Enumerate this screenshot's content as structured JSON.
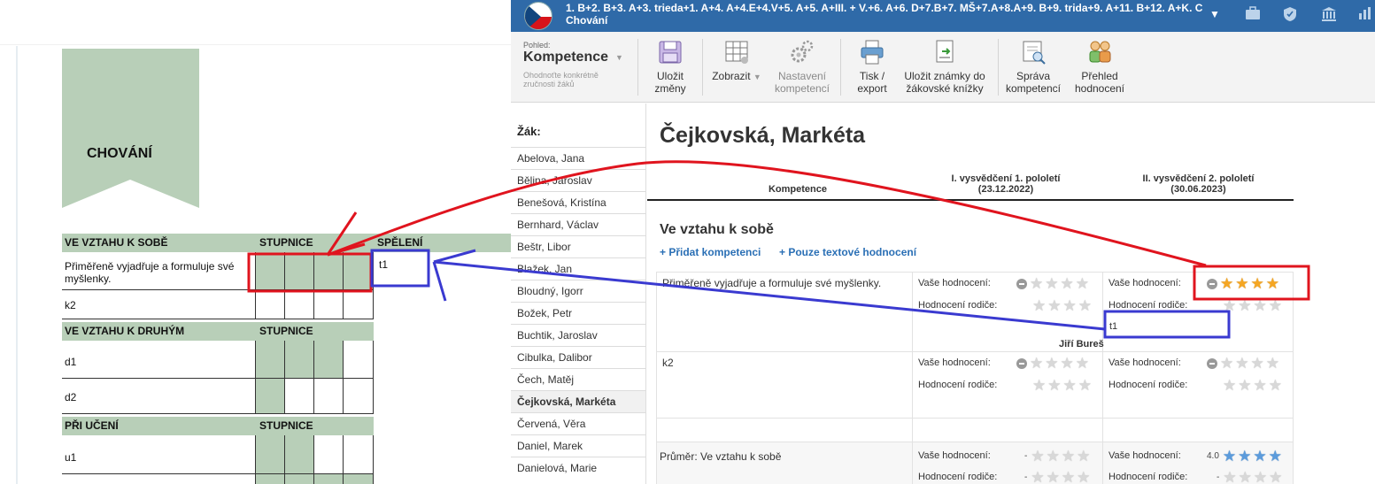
{
  "document": {
    "ribbon_title": "CHOVÁNÍ",
    "sections": [
      {
        "title": "VE VZTAHU K SOBĚ",
        "scale_header": "STUPNICE",
        "extra_header": "SPĚLENÍ",
        "rows": [
          {
            "label": "Přiměřeně vyjadřuje a formuluje své myšlenky.",
            "note": "t1"
          },
          {
            "label": "k2"
          }
        ]
      },
      {
        "title": "VE VZTAHU K DRUHÝM",
        "scale_header": "STUPNICE",
        "rows": [
          {
            "label": "d1"
          },
          {
            "label": "d2"
          }
        ]
      },
      {
        "title": "PŘI UČENÍ",
        "scale_header": "STUPNICE",
        "rows": [
          {
            "label": "u1"
          }
        ]
      }
    ],
    "colors": {
      "accent_green": "#b8cfb8"
    }
  },
  "app": {
    "topbar": {
      "classes_line": "1. B+2. B+3. A+3. trieda+1. A+4. A+4.E+4.V+5. A+5. A+III. + V.+6. A+6. D+7.B+7. MŠ+7.A+8.A+9. B+9. trida+9. A+11. B+12. A+K. C",
      "subtitle": "Chování",
      "icons": [
        "briefcase-icon",
        "shield-icon",
        "bank-icon",
        "chart-icon"
      ],
      "color": "#2f6aa8"
    },
    "toolbar": {
      "view_label": "Pohled:",
      "view_name": "Kompetence",
      "view_desc": "Ohodnoťte konkrétně zručnosti žáků",
      "buttons": [
        {
          "label1": "Uložit",
          "label2": "změny",
          "icon": "save-icon"
        },
        {
          "label1": "Zobrazit",
          "label2": "",
          "icon": "grid-icon"
        },
        {
          "label1": "Nastavení",
          "label2": "kompetencí",
          "icon": "gears-icon"
        },
        {
          "label1": "Tisk /",
          "label2": "export",
          "icon": "printer-icon"
        },
        {
          "label1": "Uložit známky do",
          "label2": "žákovské knížky",
          "icon": "book-export-icon"
        },
        {
          "label1": "Správa",
          "label2": "kompetencí",
          "icon": "manage-icon"
        },
        {
          "label1": "Přehled",
          "label2": "hodnocení",
          "icon": "people-icon"
        }
      ]
    },
    "sidebar": {
      "title": "Žák:",
      "students": [
        "Abelova, Jana",
        "Bělina, Jaroslav",
        "Benešová, Kristína",
        "Bernhard, Václav",
        "Beštr, Libor",
        "Blažek, Jan",
        "Bloudný, Igorr",
        "Božek, Petr",
        "Buchtik, Jaroslav",
        "Cibulka, Dalibor",
        "Čech, Matěj",
        "Čejkovská, Markéta",
        "Červená, Věra",
        "Daniel, Marek",
        "Danielová, Marie"
      ],
      "active_index": 11
    },
    "main": {
      "student_name": "Čejkovská, Markéta",
      "col_competence": "Kompetence",
      "col1_title": "I. vysvědčení 1. pololetí",
      "col1_date": "(23.12.2022)",
      "col2_title": "II. vysvědčení 2. pololetí",
      "col2_date": "(30.06.2023)",
      "section_title": "Ve vztahu k sobě",
      "link_add": "+ Přidat kompetenci",
      "link_text_only": "+ Pouze textové hodnocení",
      "your_eval": "Vaše hodnocení:",
      "parent_eval": "Hodnocení rodiče:",
      "rows": [
        {
          "label": "Přiměřeně vyjadřuje a formuluje své myšlenky.",
          "p1_stars": 0,
          "p2_stars": 4,
          "note": "t1",
          "teacher": "Jiří Bureš"
        },
        {
          "label": "k2",
          "p1_stars": 0,
          "p2_stars": 0
        },
        {
          "label": "Průměr: Ve vztahu k sobě",
          "p1_avg": "-",
          "p2_avg": "4.0",
          "p2_parent_avg": "-",
          "p2_stars": 4
        }
      ]
    }
  },
  "annotation_colors": {
    "red": "#e0141e",
    "blue": "#3a3ad0"
  }
}
